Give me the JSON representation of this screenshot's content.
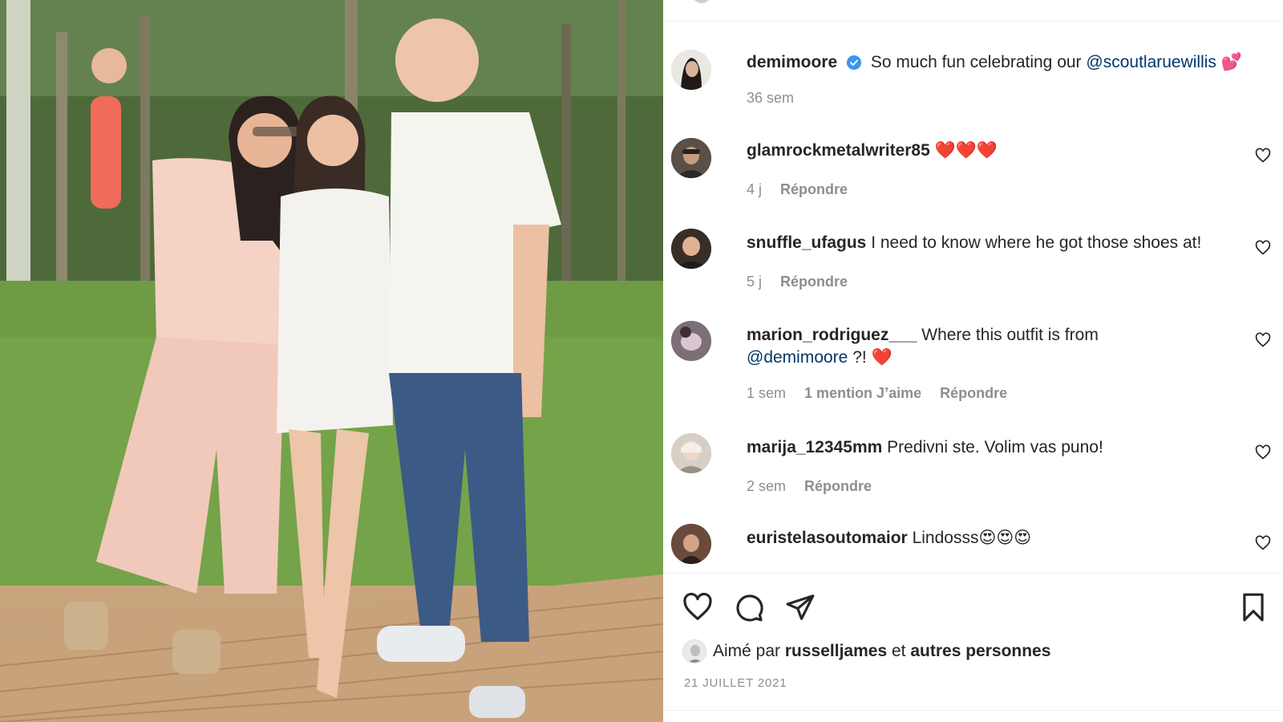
{
  "post": {
    "author": "demimoore",
    "caption": "So much fun celebrating our",
    "caption_mention": "@scoutlaruewillis",
    "caption_emoji": "💕",
    "age": "36 sem"
  },
  "comments": [
    {
      "user": "glamrockmetalwriter85",
      "text": "❤️❤️❤️",
      "age": "4 j",
      "reply": "Répondre"
    },
    {
      "user": "snuffle_ufagus",
      "text": "I need to know where he got those shoes at!",
      "age": "5 j",
      "reply": "Répondre"
    },
    {
      "user": "marion_rodriguez___",
      "text": "Where this outfit is from",
      "text_line2_mention": "@demimoore",
      "text_line2_rest": "?! ❤️",
      "age": "1 sem",
      "likes": "1 mention J’aime",
      "reply": "Répondre"
    },
    {
      "user": "marija_12345mm",
      "text": "Predivni ste. Volim vas puno!",
      "age": "2 sem",
      "reply": "Répondre"
    },
    {
      "user": "euristelasoutomaior",
      "text": "Lindosss😍😍😍"
    }
  ],
  "likes": {
    "prefix": "Aimé par",
    "user": "russelljames",
    "middle": "et",
    "suffix": "autres personnes"
  },
  "date": "21 JUILLET 2021",
  "icons": [
    "heart-icon",
    "comment-icon",
    "share-icon",
    "bookmark-icon",
    "verified-badge-icon",
    "heart-small-icon"
  ],
  "colors": {
    "mention": "#00376b",
    "verified": "#3897f0",
    "meta": "#8e8e8e",
    "heart_red": "#ed4956"
  }
}
